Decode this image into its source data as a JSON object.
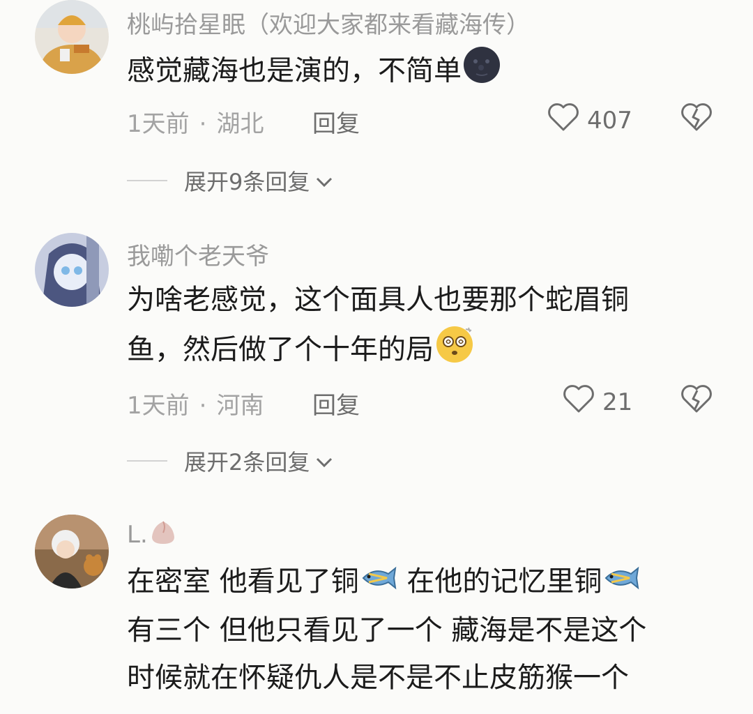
{
  "comments": [
    {
      "username": "桃屿拾星眠（欢迎大家都来看藏海传）",
      "lines": [
        "感觉藏海也是演的，不简单"
      ],
      "emoji_names": [
        "new-moon-face-emoji"
      ],
      "time": "1天前",
      "location": "湖北",
      "reply_label": "回复",
      "likes": "407",
      "expand_label": "展开9条回复"
    },
    {
      "username": "我嘞个老天爷",
      "lines": [
        "为啥老感觉，这个面具人也要那个蛇眉铜",
        "鱼，然后做了个十年的局"
      ],
      "emoji_names": [
        "dizzy-face-emoji"
      ],
      "time": "1天前",
      "location": "河南",
      "reply_label": "回复",
      "likes": "21",
      "expand_label": "展开2条回复"
    },
    {
      "username": "L.",
      "username_emoji": "peach-bun-emoji",
      "lines": [
        "在密室 他看见了铜",
        " 在他的记忆里铜",
        "有三个 但他只看见了一个 藏海是不是这个",
        "时候就在怀疑仇人是不是不止皮筋猴一个"
      ],
      "emoji_names": [
        "fish-emoji"
      ]
    }
  ],
  "colors": {
    "username": "#9a9a9a",
    "text": "#1b1b1b",
    "meta": "#a3a3a3",
    "background": "#fbfbf9"
  }
}
